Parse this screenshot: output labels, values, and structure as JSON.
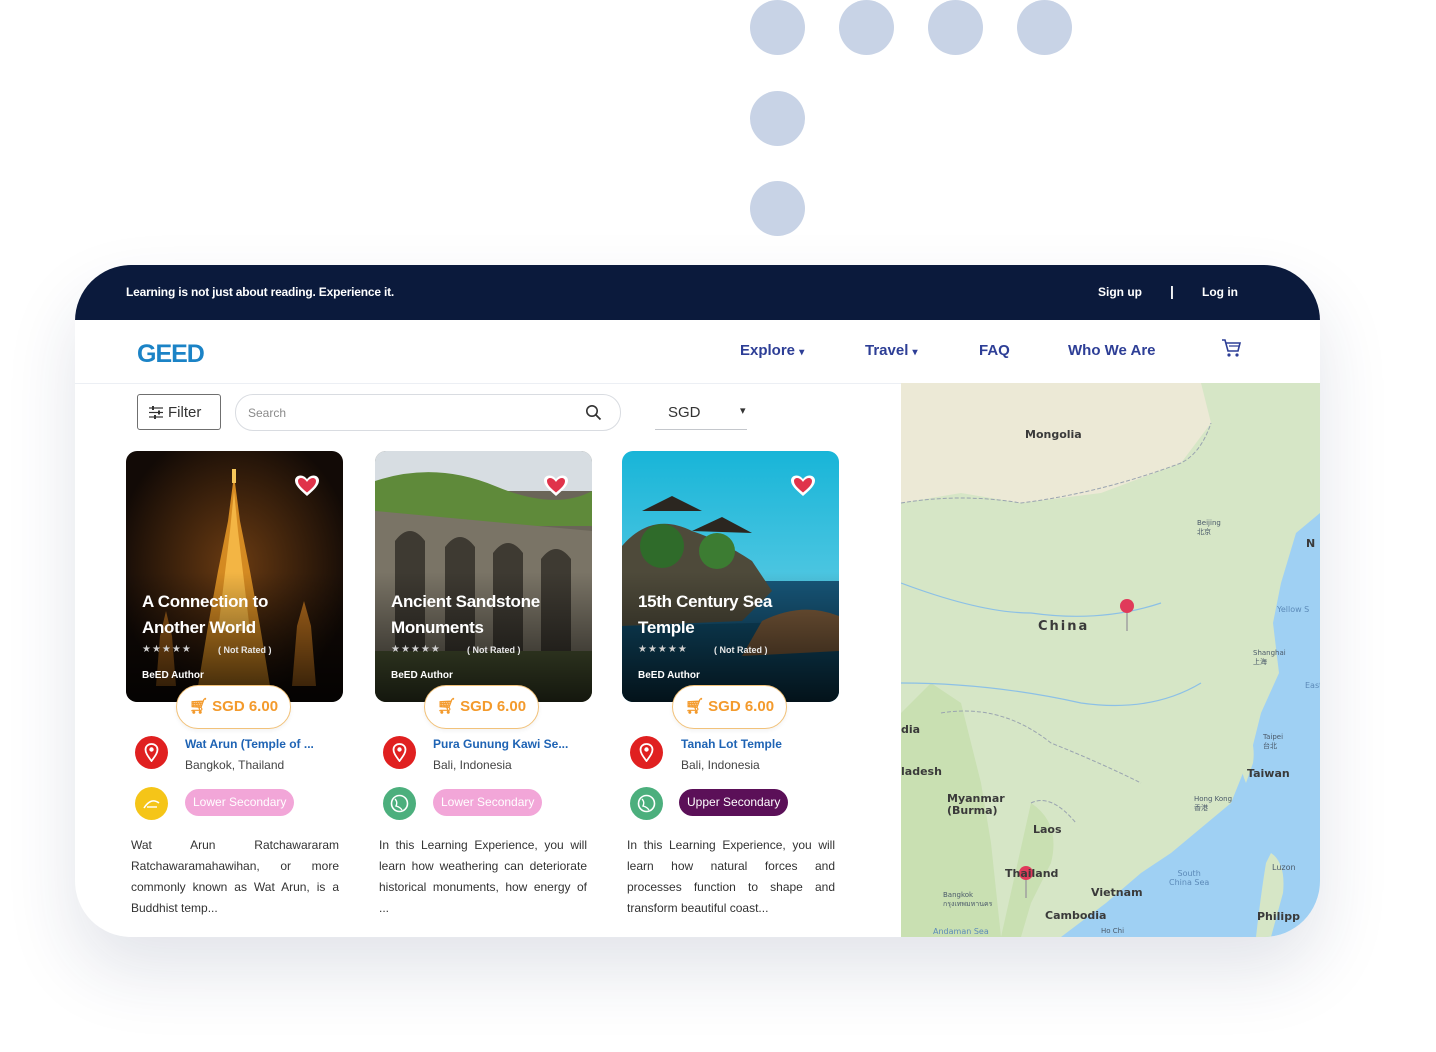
{
  "topbar": {
    "tagline": "Learning is not just about reading. Experience it.",
    "signup": "Sign up",
    "separator": "|",
    "login": "Log in"
  },
  "navbar": {
    "logo": "GEED",
    "explore": "Explore",
    "travel": "Travel",
    "faq": "FAQ",
    "who_we_are": "Who We Are",
    "dropdown_caret": "▾",
    "cart_icon": "cart-icon"
  },
  "toolbar": {
    "filter_label": "Filter",
    "search_placeholder": "Search",
    "currency": "SGD",
    "currency_caret": "▾"
  },
  "cards": [
    {
      "title": "A Connection to Another World",
      "stars": "★★★★★",
      "rating": "( Not Rated )",
      "author": "BeED Author",
      "price": "SGD 6.00",
      "location_name": "Wat Arun (Temple of ...",
      "location": "Bangkok, Thailand",
      "level": "Lower Secondary",
      "level_color": "#f2a6d8",
      "subject_color": "#f5c518",
      "description": "Wat Arun Ratchawararam Ratchawaramahawihan, or more commonly known as Wat Arun, is a Buddhist temp..."
    },
    {
      "title": "Ancient Sandstone Monuments",
      "stars": "★★★★★",
      "rating": "( Not Rated )",
      "author": "BeED Author",
      "price": "SGD 6.00",
      "location_name": "Pura Gunung Kawi Se...",
      "location": "Bali, Indonesia",
      "level": "Lower Secondary",
      "level_color": "#f2a6d8",
      "subject_color": "#4caf7d",
      "description": "In this Learning Experience, you will learn how weathering can deteriorate historical monuments, how energy of ..."
    },
    {
      "title": "15th Century Sea Temple",
      "stars": "★★★★★",
      "rating": "( Not Rated )",
      "author": "BeED Author",
      "price": "SGD 6.00",
      "location_name": "Tanah Lot Temple",
      "location": "Bali, Indonesia",
      "level": "Upper Secondary",
      "level_color": "#5b1058",
      "subject_color": "#4caf7d",
      "description": "In this Learning Experience, you will learn how natural forces and processes function to shape and transform beautiful coast..."
    }
  ],
  "map": {
    "labels": {
      "mongolia": "Mongolia",
      "china": "China",
      "myanmar": "Myanmar\n(Burma)",
      "laos": "Laos",
      "thailand": "Thailand",
      "vietnam": "Vietnam",
      "cambodia": "Cambodia",
      "taiwan": "Taiwan",
      "philippines": "Philipp",
      "bangladesh": "ladesh",
      "north_korea_fragment": "N",
      "india_fragment": "dia",
      "beijing": "Beijing\n北京",
      "shanghai": "Shanghai\n上海",
      "taipei": "Taipei\n台北",
      "hong_kong": "Hong Kong\n香港",
      "bangkok": "Bangkok\nกรุงเทพมหานคร",
      "yellow_sea": "Yellow S",
      "south_china_sea": "South\nChina Sea",
      "andaman_sea": "Andaman Sea",
      "luzon": "Luzon",
      "east_fragment": "East",
      "hochi_fragment": "Ho Chi"
    },
    "colors": {
      "land": "#d6e6c6",
      "water": "#9fd0f3"
    }
  }
}
